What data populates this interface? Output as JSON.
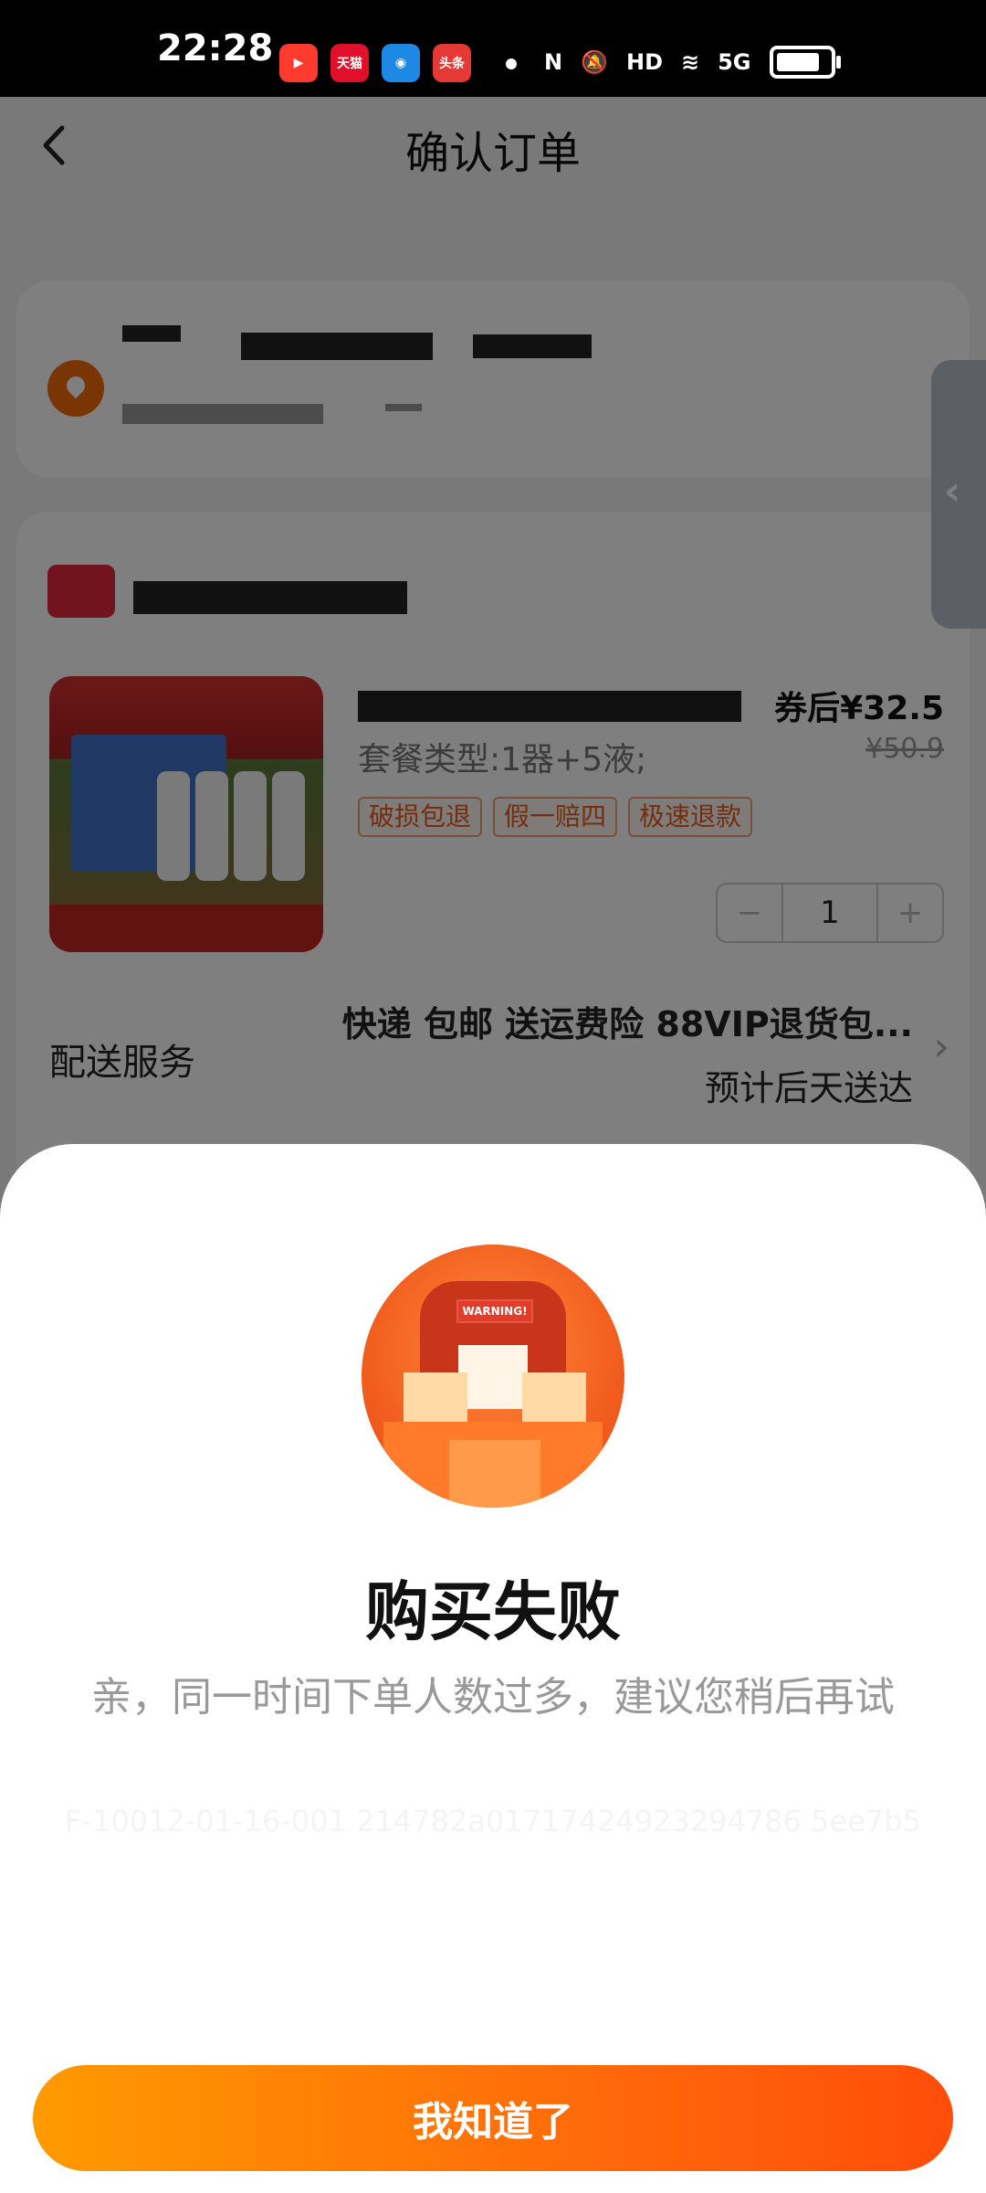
{
  "status_bar": {
    "time": "22:28",
    "app_icons": [
      "video-app-icon",
      "tmall-618-icon",
      "map-app-icon",
      "toutiao-icon"
    ],
    "tmall_label": "天猫",
    "toutiao_label": "头条",
    "network": "5G",
    "hd": "HD"
  },
  "header": {
    "title": "确认订单"
  },
  "product": {
    "spec": "套餐类型:1器+5液;",
    "tags": [
      "破损包退",
      "假一赔四",
      "极速退款"
    ],
    "price_after_coupon": "券后¥32.5",
    "original_price": "¥50.9",
    "quantity": "1",
    "minus": "−",
    "plus": "+"
  },
  "delivery": {
    "label": "配送服务",
    "main": "快递 包邮 送运费险 88VIP退货包...",
    "estimate": "预计后天送达"
  },
  "dialog": {
    "title": "购买失败",
    "message": "亲，同一时间下单人数过多，建议您稍后再试",
    "error_code": "F-10012-01-16-001 214782a01717424923294786 5ee7b5",
    "button": "我知道了"
  },
  "colors": {
    "accent": "#ff6a0a",
    "tag_text": "#e85a1f",
    "location_icon": "#f46a0a"
  }
}
